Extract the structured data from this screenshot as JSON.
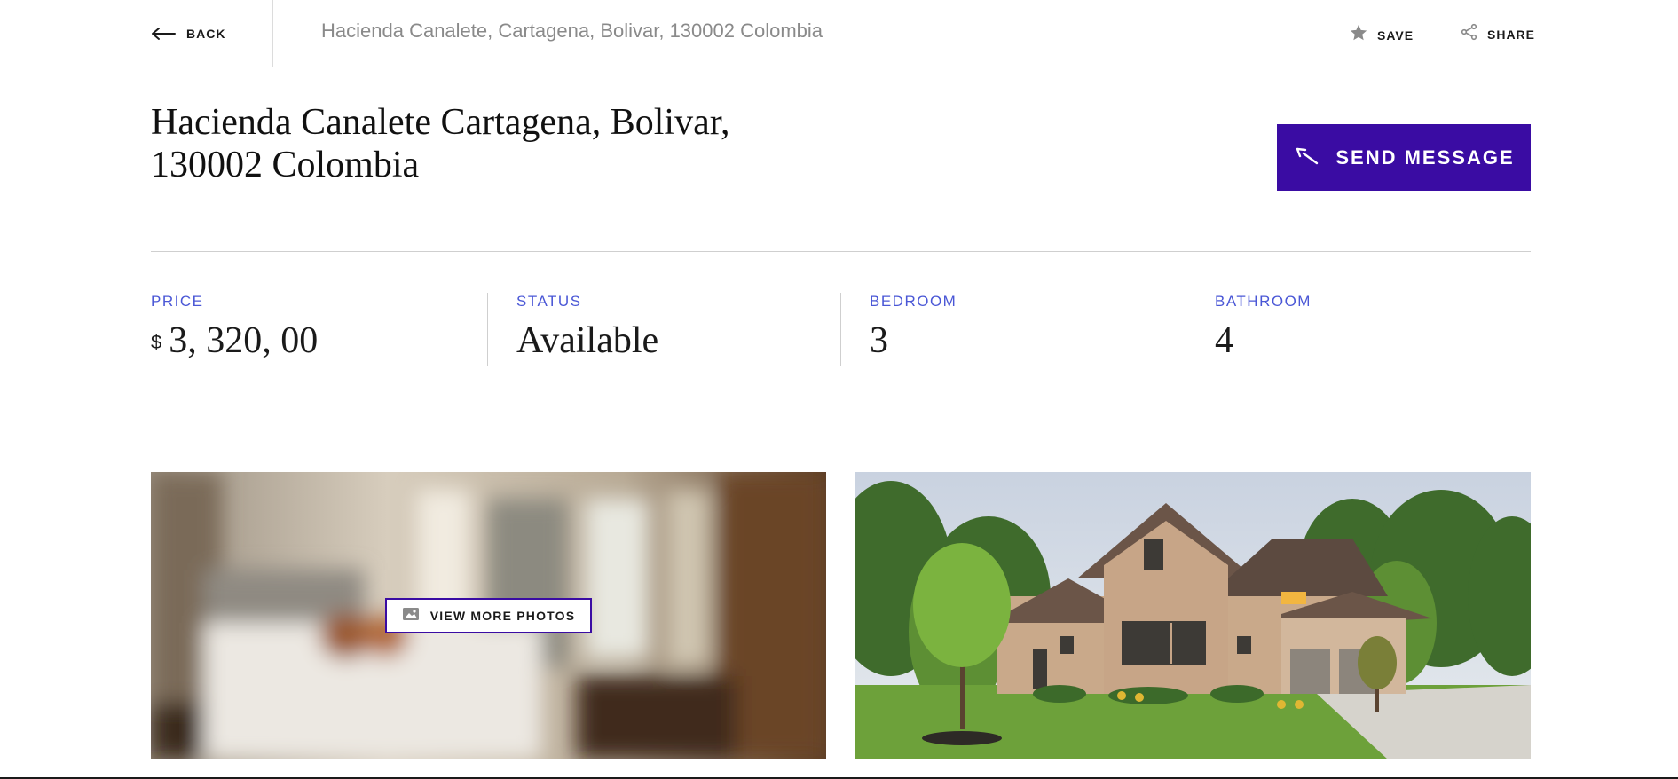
{
  "header": {
    "back_label": "BACK",
    "address": "Hacienda Canalete, Cartagena, Bolivar, 130002 Colombia",
    "save_label": "SAVE",
    "share_label": "SHARE",
    "icons": {
      "back": "arrow-left-icon",
      "save": "star-icon",
      "share": "share-icon"
    }
  },
  "listing": {
    "title_line1": "Hacienda Canalete Cartagena, Bolivar,",
    "title_line2": "130002 Colombia",
    "send_message_label": "SEND MESSAGE",
    "send_icon": "arrow-up-left-icon"
  },
  "stats": [
    {
      "label": "PRICE",
      "currency": "$",
      "value": "3, 320, 00"
    },
    {
      "label": "STATUS",
      "value": "Available"
    },
    {
      "label": "BEDROOM",
      "value": "3"
    },
    {
      "label": "BATHROOM",
      "value": "4"
    }
  ],
  "gallery": {
    "view_more_label": "VIEW MORE PHOTOS",
    "view_more_icon": "image-icon",
    "photos": [
      {
        "subject": "bedroom-interior",
        "blurred": true
      },
      {
        "subject": "house-exterior",
        "blurred": false
      }
    ]
  },
  "colors": {
    "accent": "#3a0ca3",
    "stat_label": "#4a57d6",
    "muted_text": "#8a8a8a",
    "divider": "#dcdcdc"
  }
}
